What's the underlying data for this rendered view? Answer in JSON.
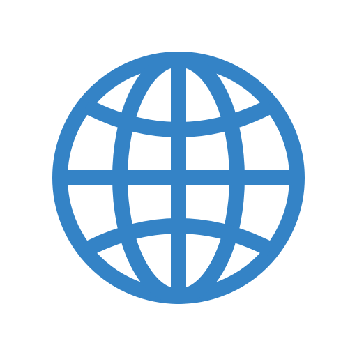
{
  "icon": {
    "name": "globe-icon",
    "color": "#3483c6",
    "background": "#ffffff"
  }
}
